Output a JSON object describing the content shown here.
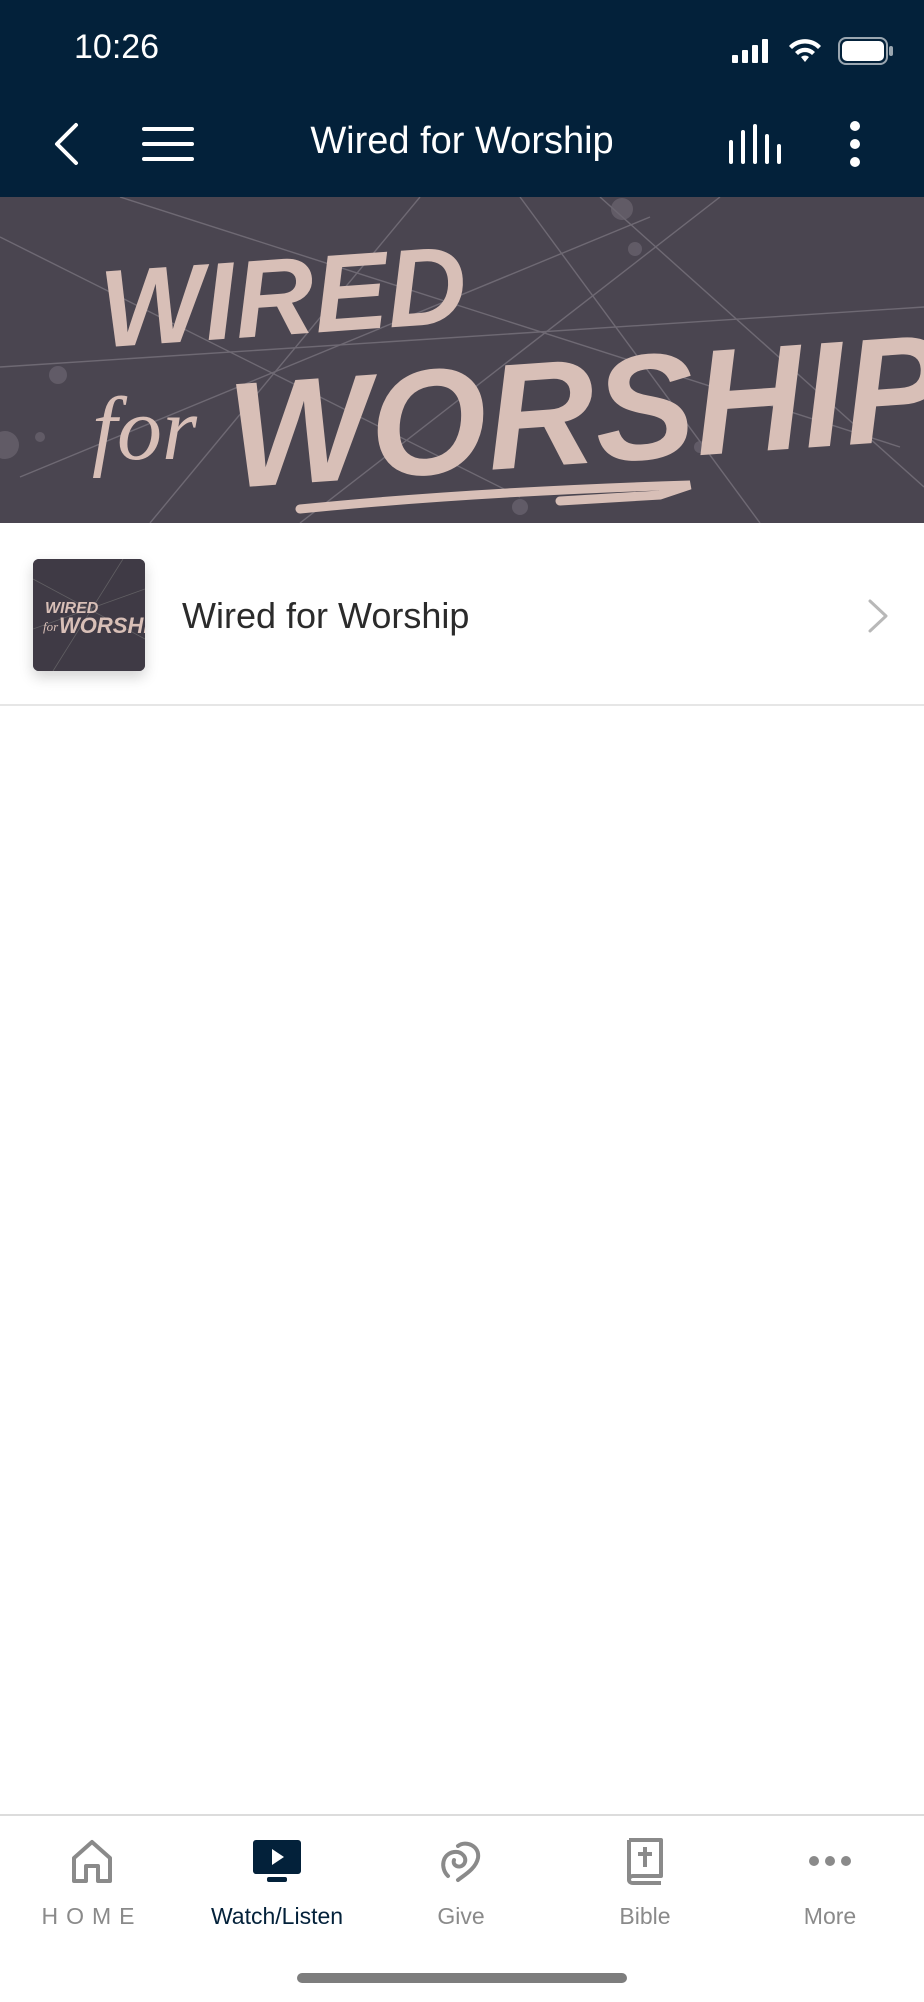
{
  "status": {
    "time": "10:26"
  },
  "nav": {
    "title": "Wired for Worship"
  },
  "banner": {
    "line1": "WIRED",
    "line2_small": "for",
    "line2_big": "WORSHIP"
  },
  "list": [
    {
      "title": "Wired for Worship",
      "thumb_line1": "WIRED",
      "thumb_small": "for",
      "thumb_big": "WORSHIP"
    }
  ],
  "tabs": [
    {
      "label": "HOME",
      "icon": "home-icon"
    },
    {
      "label": "Watch/Listen",
      "icon": "play-monitor-icon"
    },
    {
      "label": "Give",
      "icon": "give-icon"
    },
    {
      "label": "Bible",
      "icon": "bible-icon"
    },
    {
      "label": "More",
      "icon": "more-dots-icon"
    }
  ],
  "colors": {
    "header": "#03213a",
    "banner_bg": "#4a4550",
    "accent_text": "#d8bfb7",
    "tab_active": "#03213a",
    "tab_inactive": "#8a8a8a"
  }
}
